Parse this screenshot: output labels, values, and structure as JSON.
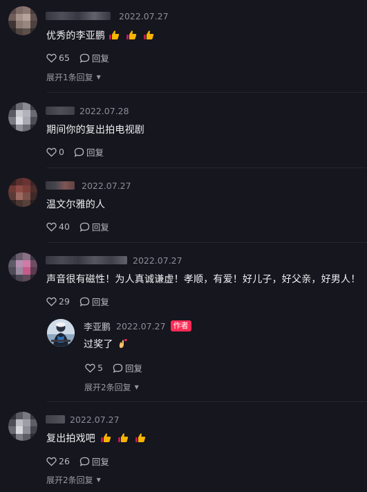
{
  "comments": [
    {
      "username": "",
      "date": "2022.07.27",
      "text": "优秀的李亚鹏",
      "likes": "65",
      "reply_label": "回复",
      "expand_label": "展开1条回复",
      "emoji": [
        "thumbs-up",
        "thumbs-up",
        "thumbs-up"
      ]
    },
    {
      "username": "",
      "date": "2022.07.28",
      "text": "期间你的复出拍电视剧",
      "likes": "0",
      "reply_label": "回复"
    },
    {
      "username": "",
      "date": "2022.07.27",
      "text": "温文尔雅的人",
      "likes": "40",
      "reply_label": "回复"
    },
    {
      "username": "",
      "date": "2022.07.27",
      "text": "声音很有磁性！为人真诚谦虚！孝顺，有爱！好儿子，好父亲，好男人！",
      "likes": "29",
      "reply_label": "回复",
      "reply": {
        "username": "李亚鹏",
        "date": "2022.07.27",
        "badge": "作者",
        "text": "过奖了",
        "emoji": [
          "finger-heart"
        ],
        "likes": "5",
        "reply_label": "回复",
        "expand_label": "展开2条回复"
      }
    },
    {
      "username": "",
      "date": "2022.07.27",
      "text": "复出拍戏吧",
      "likes": "26",
      "reply_label": "回复",
      "expand_label": "展开2条回复",
      "emoji": [
        "thumbs-up",
        "thumbs-up",
        "thumbs-up"
      ]
    }
  ],
  "colors": {
    "background": "#16161e",
    "accent": "#fe2c55",
    "muted": "#8e8e99"
  }
}
